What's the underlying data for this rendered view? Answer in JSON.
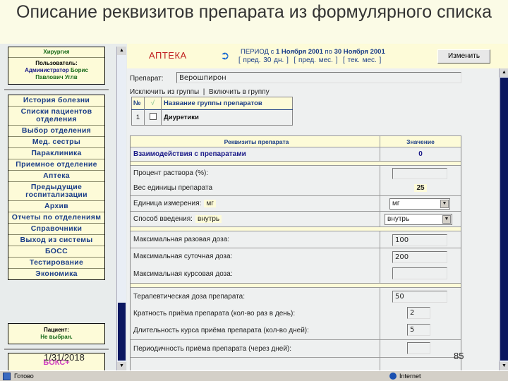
{
  "slide": {
    "title": "Описание реквизитов препарата из формулярного списка",
    "date": "1/31/2018",
    "page": "85"
  },
  "sidebar": {
    "department": "Хирургия",
    "user_label": "Пользователь:",
    "user_role": "Администратор",
    "user_name": "Борис Павлович Углв",
    "nav": [
      "История болезни",
      "Списки пациентов отделения",
      "Выбор отделения",
      "Мед. сестры",
      "Параклиника",
      "Приемное отделение",
      "Аптека",
      "Предыдущие госпитализации",
      "Архив",
      "Отчеты по отделениям",
      "Справочники",
      "Выход из системы",
      "БОСС",
      "Тестирование",
      "Экономика"
    ],
    "patient_label": "Пациент:",
    "patient_value": "Не выбран.",
    "box_label": "БОКС+"
  },
  "header": {
    "section": "АПТЕКА",
    "period_prefix": "ПЕРИОД с",
    "period_from": "1 Ноября 2001",
    "period_to_prefix": "по",
    "period_to": "30 Ноября 2001",
    "links": [
      "[ пред. 30 дн. ]",
      "[ пред. мес. ]",
      "[ тек. мес. ]"
    ],
    "change_button": "Изменить"
  },
  "drug": {
    "label": "Препарат:",
    "value": "Верошпирон"
  },
  "group_links": {
    "exclude": "Исключить из группы",
    "sep": "|",
    "include": "Включить в группу"
  },
  "group_table": {
    "headers": [
      "№",
      "√",
      "Название группы препаратов"
    ],
    "rows": [
      {
        "num": "1",
        "checked": false,
        "name": "Диуретики"
      }
    ]
  },
  "props": {
    "headers": [
      "Реквизиты препарата",
      "Значение"
    ],
    "interaction": {
      "label": "Взаимодействия с препаратами",
      "value": "0"
    },
    "percent": {
      "label": "Процент раствора (%):",
      "value": ""
    },
    "unit_weight": {
      "label": "Вес единицы препарата",
      "value": "25"
    },
    "unit": {
      "label": "Единица измерения:",
      "current": "мг",
      "selected": "мг"
    },
    "route": {
      "label": "Способ введения:",
      "current": "внутрь",
      "selected": "внутрь"
    },
    "max_single": {
      "label": "Максимальная разовая доза:",
      "value": "100"
    },
    "max_daily": {
      "label": "Максимальная суточная доза:",
      "value": "200"
    },
    "max_course": {
      "label": "Максимальная курсовая доза:",
      "value": ""
    },
    "therapeutic": {
      "label": "Терапевтическая доза препарата:",
      "value": "50"
    },
    "frequency": {
      "label": "Кратность приёма препарата (кол-во раз в день):",
      "value": "2"
    },
    "duration": {
      "label": "Длительность курса приёма препарата (кол-во дней):",
      "value": "5"
    },
    "periodicity": {
      "label": "Периодичность приёма препарата (через дней):",
      "value": ""
    }
  },
  "statusbar": {
    "status": "Готово",
    "zone": "Internet"
  }
}
